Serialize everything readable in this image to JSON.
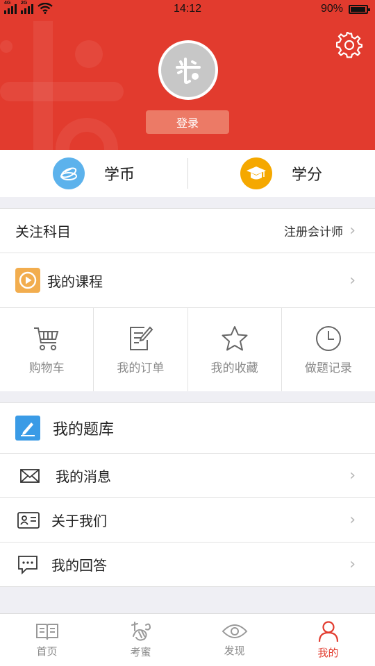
{
  "status_bar": {
    "network_1": "4G",
    "network_2": "2G",
    "time": "14:12",
    "battery": "90%"
  },
  "header": {
    "login_label": "登录",
    "settings_icon": "gear-icon",
    "accent_color": "#e23b2e"
  },
  "wallet": {
    "coins_label": "学币",
    "credits_label": "学分",
    "coins_color": "#5cb2ec",
    "credits_color": "#f5a800"
  },
  "subjects": {
    "label": "关注科目",
    "value": "注册会计师"
  },
  "courses": {
    "label": "我的课程"
  },
  "shortcuts": [
    {
      "label": "购物车",
      "icon": "cart-icon"
    },
    {
      "label": "我的订单",
      "icon": "order-icon"
    },
    {
      "label": "我的收藏",
      "icon": "star-icon"
    },
    {
      "label": "做题记录",
      "icon": "clock-icon"
    }
  ],
  "question_bank": {
    "label": "我的题库"
  },
  "menu": [
    {
      "label": "我的消息",
      "icon": "envelope-icon"
    },
    {
      "label": "关于我们",
      "icon": "id-card-icon"
    },
    {
      "label": "我的回答",
      "icon": "chat-icon"
    }
  ],
  "tabbar": [
    {
      "label": "首页",
      "icon": "book-icon"
    },
    {
      "label": "考蜜",
      "icon": "bee-icon"
    },
    {
      "label": "发现",
      "icon": "eye-icon"
    },
    {
      "label": "我的",
      "icon": "person-icon",
      "active": true
    }
  ]
}
